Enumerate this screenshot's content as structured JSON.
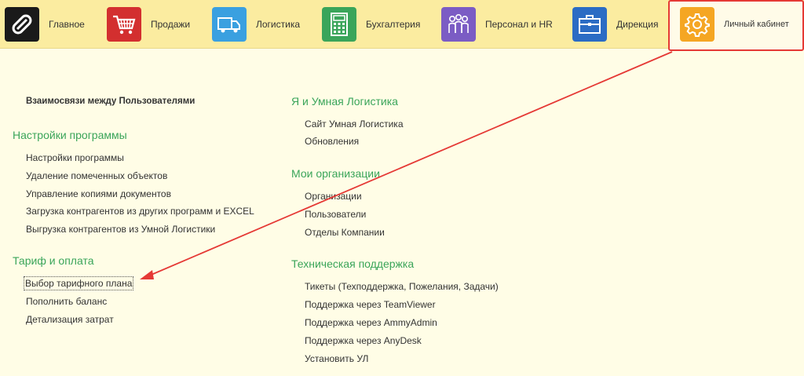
{
  "nav": {
    "items": [
      {
        "label": "Главное",
        "icon": "link-logo-icon",
        "color": "#1a1a1a"
      },
      {
        "label": "Продажи",
        "icon": "shopping-cart-icon",
        "color": "#d32f2f"
      },
      {
        "label": "Логистика",
        "icon": "truck-icon",
        "color": "#3aa0e0"
      },
      {
        "label": "Бухгалтерия",
        "icon": "calculator-icon",
        "color": "#3aa55a"
      },
      {
        "label": "Персонал и HR",
        "icon": "people-icon",
        "color": "#7b5cc4"
      },
      {
        "label": "Дирекция",
        "icon": "briefcase-icon",
        "color": "#2b6cc4"
      },
      {
        "label": "Личный кабинет",
        "icon": "gear-icon",
        "color": "#f5a623"
      }
    ]
  },
  "left": {
    "top_link": "Взаимосвязи между Пользователями",
    "settings": {
      "title": "Настройки программы",
      "links": [
        "Настройки программы",
        "Удаление помеченных объектов",
        "Управление копиями документов",
        "Загрузка контрагентов из других программ и EXCEL",
        "Выгрузка контрагентов из Умной Логистики"
      ]
    },
    "tariff": {
      "title": "Тариф и оплата",
      "links": [
        "Выбор тарифного плана",
        "Пополнить баланс",
        "Детализация затрат"
      ]
    }
  },
  "right": {
    "me": {
      "title": "Я и Умная Логистика",
      "links": [
        "Сайт Умная Логистика",
        "Обновления"
      ]
    },
    "orgs": {
      "title": "Мои организации",
      "links": [
        "Организации",
        "Пользователи",
        "Отделы Компании"
      ]
    },
    "support": {
      "title": "Техническая поддержка",
      "links": [
        "Тикеты (Техподдержка, Пожелания, Задачи)",
        "Поддержка через TeamViewer",
        "Поддержка через AmmyAdmin",
        "Поддержка через AnyDesk",
        "Установить УЛ"
      ]
    }
  },
  "colors": {
    "section_title": "#3aa55a",
    "highlight": "#e53935",
    "topbar": "#fbeca0",
    "background": "#fffde6"
  }
}
